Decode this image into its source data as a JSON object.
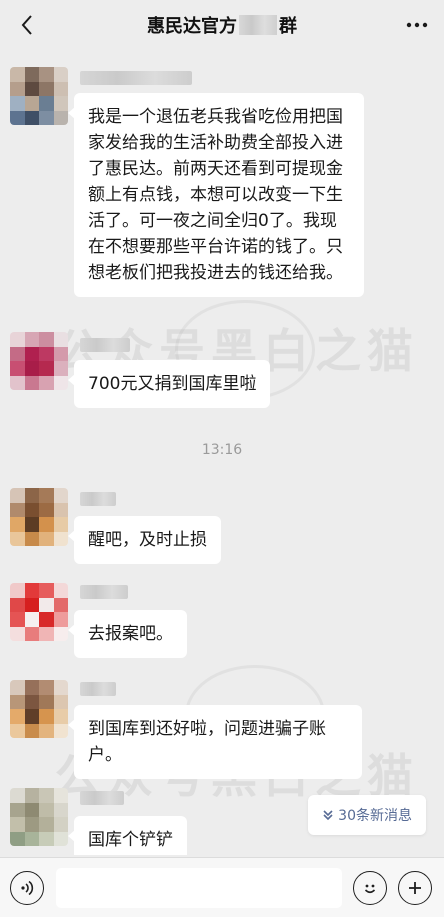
{
  "header": {
    "title_prefix": "惠民达官方",
    "title_suffix": "群",
    "back_icon": "chevron-left-icon",
    "more_icon": "more-dots-icon"
  },
  "messages": [
    {
      "id": "m1",
      "text": "我是一个退伍老兵我省吃俭用把国家发给我的生活补助费全部投入进了惠民达。前两天还看到可提现金额上有点钱，本想可以改变一下生活了。可一夜之间全归0了。我现在不想要那些平台许诺的钱了。只想老板们把我投进去的钱还给我。"
    },
    {
      "id": "m2",
      "text": "700元又捐到国库里啦"
    },
    {
      "id": "m3",
      "text": "醒吧，及时止损"
    },
    {
      "id": "m4",
      "text": "去报案吧。"
    },
    {
      "id": "m5",
      "text": "到国库到还好啦，问题进骗子账户。"
    },
    {
      "id": "m6",
      "text": "国库个铲铲"
    }
  ],
  "timestamp": "13:16",
  "new_messages": {
    "label": "30条新消息",
    "icon": "double-chevron-down-icon"
  },
  "watermark": {
    "text": "公众号黑白之猫"
  },
  "input_bar": {
    "voice_icon": "voice-icon",
    "emoji_icon": "emoji-icon",
    "plus_icon": "plus-icon",
    "placeholder": ""
  },
  "colors": {
    "background": "#ededed",
    "bubble": "#ffffff",
    "link": "#576b95"
  }
}
